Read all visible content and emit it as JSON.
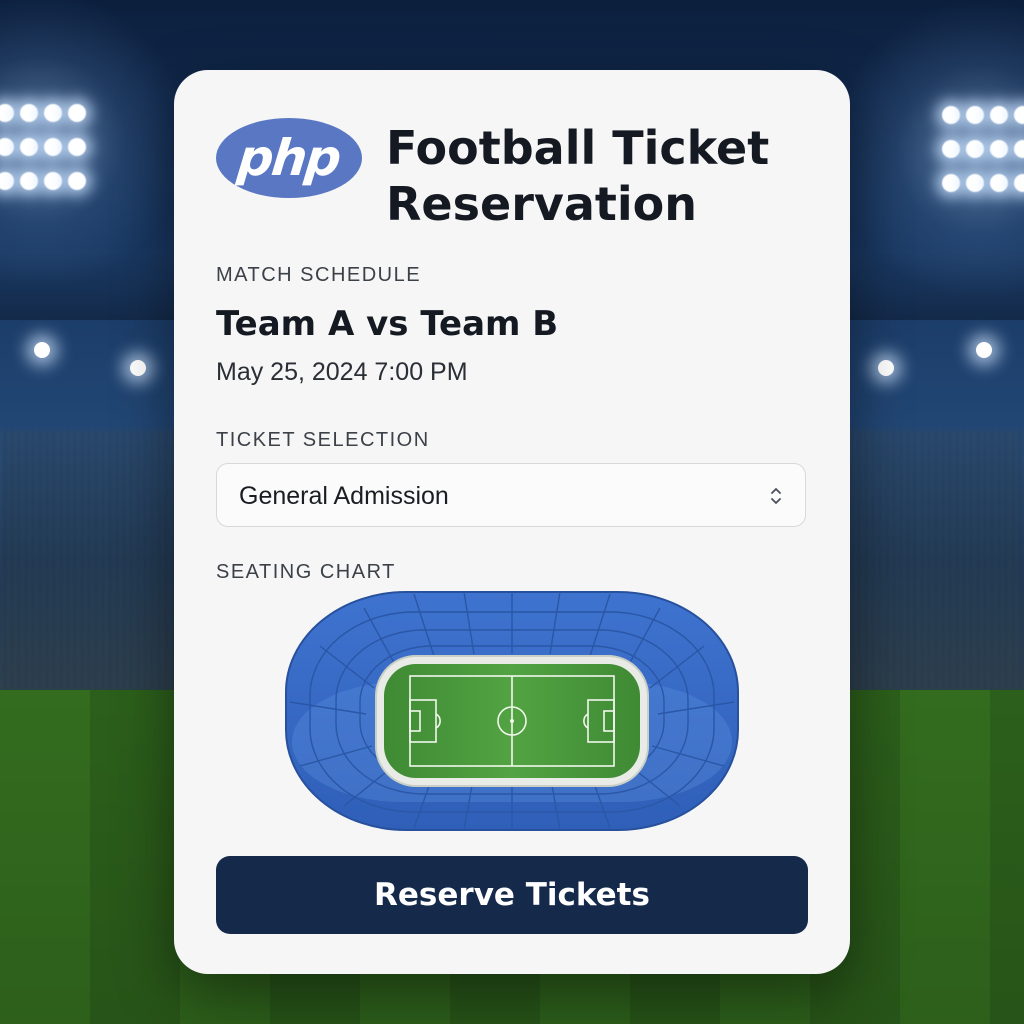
{
  "header": {
    "logo_text": "php",
    "title": "Football Ticket Reservation"
  },
  "match": {
    "section_label": "MATCH SCHEDULE",
    "title": "Team A vs Team B",
    "datetime": "May 25, 2024 7:00 PM"
  },
  "tickets": {
    "section_label": "TICKET SELECTION",
    "selected": "General Admission"
  },
  "seating": {
    "section_label": "SEATING CHART"
  },
  "actions": {
    "reserve_label": "Reserve Tickets"
  },
  "colors": {
    "logo": "#5a77c4",
    "button": "#15294a",
    "seats": "#3f6fc8",
    "pitch": "#4c9a3a"
  },
  "icons": {
    "select": "chevron-up-down-icon"
  }
}
